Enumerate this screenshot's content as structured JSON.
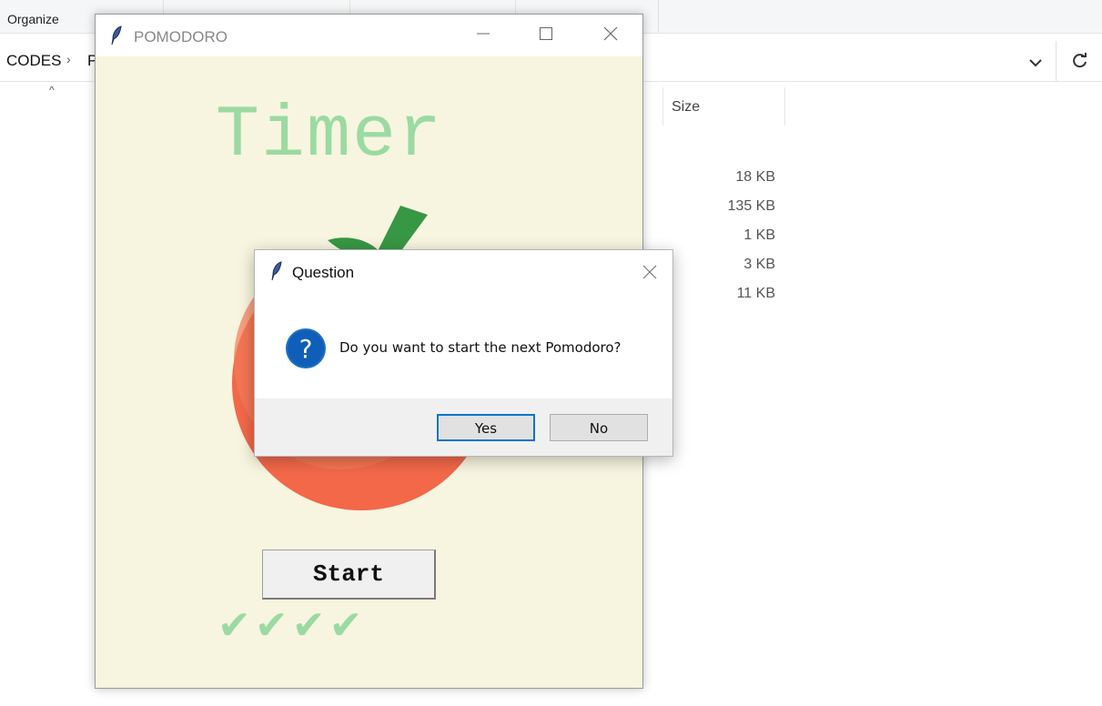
{
  "explorer": {
    "ribbon_label": "Organize",
    "breadcrumb": [
      "CODES",
      "P"
    ],
    "breadcrumb_separator": "›",
    "sort_caret": "^",
    "column_size_header": "Size",
    "sizes": [
      "18 KB",
      "135 KB",
      "1 KB",
      "3 KB",
      "11 KB"
    ],
    "dropdown_icon": "chevron-down-icon",
    "refresh_icon": "refresh-icon"
  },
  "pomodoro": {
    "window_title": "POMODORO",
    "timer_label": "Timer",
    "start_label": "Start",
    "checkmarks": "✔✔✔✔",
    "colors": {
      "background": "#f7f5df",
      "green": "#9bdaa2",
      "tomato": "#f26849",
      "leaf": "#379744"
    }
  },
  "dialog": {
    "title": "Question",
    "message": "Do you want to start the next Pomodoro?",
    "yes_label": "Yes",
    "no_label": "No",
    "icon": "question-icon",
    "accent_color": "#0a74d0"
  }
}
